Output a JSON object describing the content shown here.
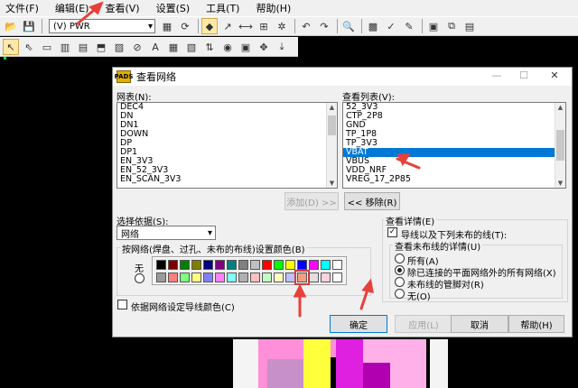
{
  "menubar": {
    "items": [
      "文件(F)",
      "编辑(E)",
      "查看(V)",
      "设置(S)",
      "工具(T)",
      "帮助(H)"
    ]
  },
  "toolbar": {
    "layer_value": "(V) PWR"
  },
  "dialog": {
    "title": "查看网络",
    "window_controls": {
      "minimize": "—",
      "maximize": "☐",
      "close": "✕"
    },
    "nets_label": "网表(N):",
    "nets": [
      "DEC4",
      "DN",
      "DN1",
      "DOWN",
      "DP",
      "DP1",
      "EN_3V3",
      "EN_52_3V3",
      "EN_SCAN_3V3"
    ],
    "view_list_label": "查看列表(V):",
    "view_list": [
      "52_3V3",
      "CTP_2P8",
      "GND",
      "TP_1P8",
      "TP_3V3",
      "VBAT",
      "VBUS",
      "VDD_NRF",
      "VREG_17_2P85"
    ],
    "selected_view": "VBAT",
    "add_button": "添加(D) >>",
    "remove_button": "<< 移除(R)",
    "select_by_label": "选择依据(S):",
    "select_by_value": "网络",
    "color_group_label": "按网络(焊盘、过孔、未布的布线)设置颜色(B)",
    "no_color_label": "无",
    "palette": [
      "#000000",
      "#800000",
      "#008000",
      "#808000",
      "#000080",
      "#800080",
      "#008080",
      "#808080",
      "#c0c0c0",
      "#ff0000",
      "#00ff00",
      "#ffff00",
      "#0000ff",
      "#ff00ff",
      "#00ffff",
      "#ffffff",
      "#9a9a9a",
      "#ff8080",
      "#80ff80",
      "#ffff80",
      "#8080ff",
      "#ff80ff",
      "#80ffff",
      "#b0b0b0",
      "#ffc0c0",
      "#c0ffc0",
      "#ffffc0",
      "#c0c0ff",
      "#f0a080",
      "#e0e0e0",
      "#ffd0e0",
      "#fafafa"
    ],
    "selected_swatch_index": 28,
    "color_by_net_label": "依据网络设定导线颜色(C)",
    "details_label": "查看详情(E)",
    "show_traces_label": "导线以及下列未布的线(T):",
    "unrouted_group_label": "查看未布线的详情(U)",
    "radio_options": [
      "所有(A)",
      "除已连接的平面网络外的所有网络(X)",
      "未布线的管脚对(R)",
      "无(O)"
    ],
    "radio_selected": 1,
    "ok_button": "确定",
    "apply_button": "应用(L)",
    "cancel_button": "取消",
    "help_button": "帮助(H)"
  },
  "colors": {
    "accent": "#0078d7",
    "annotation_arrow": "#e8403a"
  }
}
